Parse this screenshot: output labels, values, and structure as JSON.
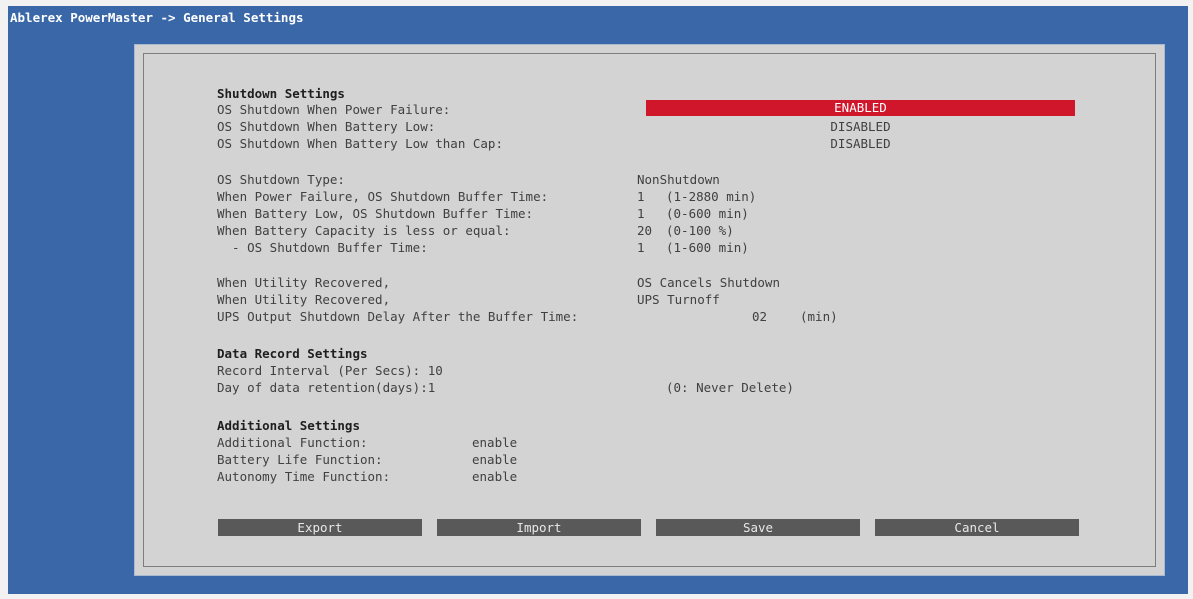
{
  "title": "Ablerex PowerMaster -> General Settings",
  "shutdown": {
    "heading": "Shutdown Settings",
    "power_failure_label": "OS Shutdown When Power Failure:",
    "power_failure_value": "ENABLED",
    "battery_low_label": "OS Shutdown When Battery Low:",
    "battery_low_value": "DISABLED",
    "battery_low_cap_label": "OS Shutdown When Battery Low than Cap:",
    "battery_low_cap_value": "DISABLED",
    "type_label": "OS Shutdown Type:",
    "type_value": "NonShutdown",
    "pf_buffer_label": "When Power Failure, OS Shutdown Buffer Time:",
    "pf_buffer_value": "1",
    "pf_buffer_range": "(1-2880 min)",
    "bl_buffer_label": "When Battery Low, OS Shutdown Buffer Time:",
    "bl_buffer_value": "1",
    "bl_buffer_range": "(0-600 min)",
    "cap_label": "When Battery Capacity is less or equal:",
    "cap_value": "20",
    "cap_range": "(0-100 %)",
    "cap_buffer_label": "  - OS Shutdown Buffer Time:",
    "cap_buffer_value": "1",
    "cap_buffer_range": "(1-600 min)",
    "recovered1_label": "When Utility Recovered,",
    "recovered1_value": "OS Cancels Shutdown",
    "recovered2_label": "When Utility Recovered,",
    "recovered2_value": "UPS Turnoff",
    "delay_label": "UPS Output Shutdown Delay After the Buffer Time:",
    "delay_value": "02",
    "delay_unit": "(min)"
  },
  "data_record": {
    "heading": "Data Record Settings",
    "interval_label": "Record Interval (Per Secs): 10",
    "retention_label": "Day of data retention(days):1",
    "retention_note": "(0: Never Delete)"
  },
  "additional": {
    "heading": "Additional Settings",
    "function_label": "Additional Function:",
    "function_value": "enable",
    "battery_life_label": "Battery Life Function:",
    "battery_life_value": "enable",
    "autonomy_label": "Autonomy Time Function:",
    "autonomy_value": "enable"
  },
  "buttons": {
    "export": "Export",
    "import": "Import",
    "save": "Save",
    "cancel": "Cancel"
  },
  "colors": {
    "background": "#3a67a8",
    "panel": "#d3d3d3",
    "highlight": "#d0162b",
    "button": "#595959"
  }
}
